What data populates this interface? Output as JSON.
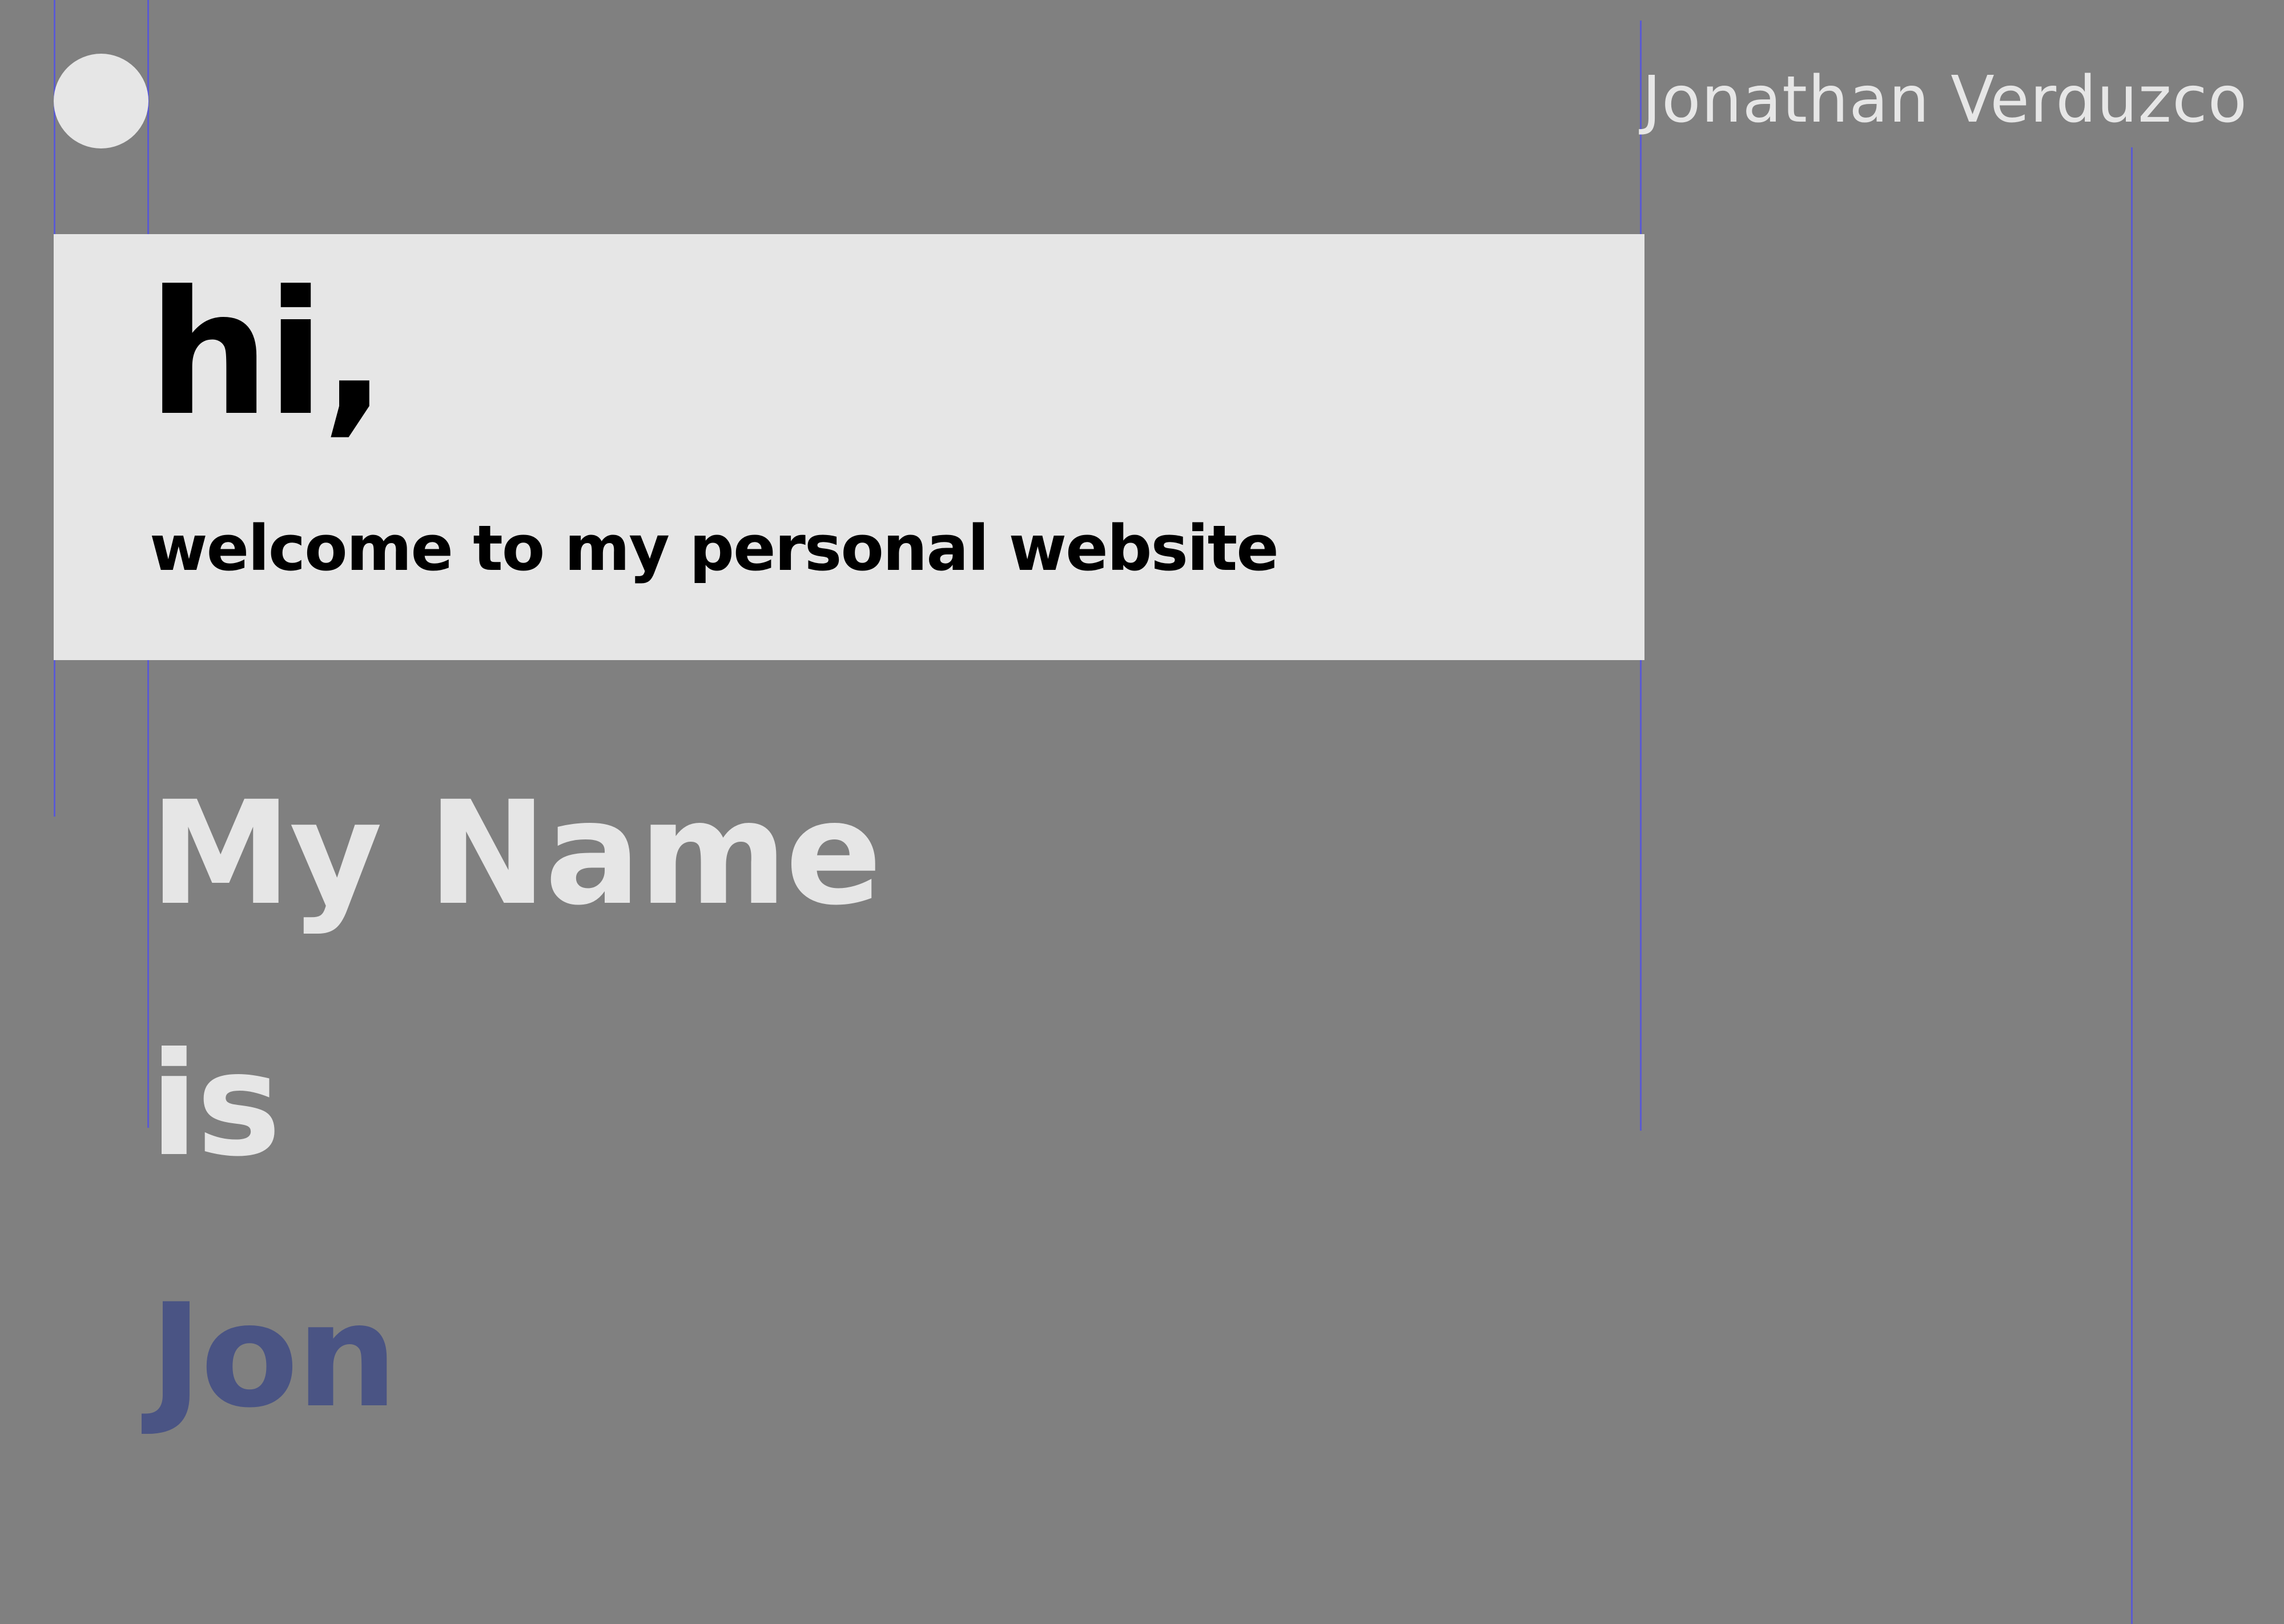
{
  "header": {
    "site_name": "Jonathan Verduzco"
  },
  "hero": {
    "greeting": "hi,",
    "subtitle": "welcome to my personal website"
  },
  "intro": {
    "line1": "My Name",
    "line2": "is",
    "line3": "Jon"
  },
  "colors": {
    "background": "#808080",
    "panel": "#e6e6e6",
    "accent": "#4a5484",
    "guide": "#5a5ad2"
  },
  "icons": {
    "logo": "circle-logo-icon"
  }
}
